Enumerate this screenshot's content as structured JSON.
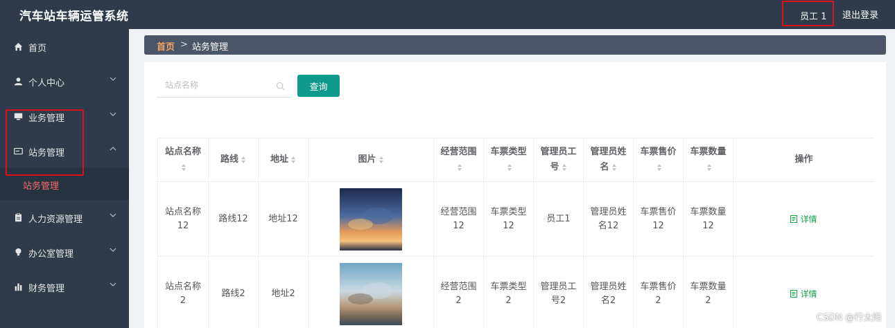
{
  "header": {
    "app_title": "汽车站车辆运管系统",
    "user_label": "员工 1",
    "logout_label": "退出登录"
  },
  "sidebar": {
    "items": [
      {
        "label": "首页",
        "icon": "home-icon"
      },
      {
        "label": "个人中心",
        "icon": "user-icon"
      },
      {
        "label": "业务管理",
        "icon": "monitor-icon"
      },
      {
        "label": "站务管理",
        "icon": "card-icon",
        "expanded": true,
        "children": [
          {
            "label": "站务管理"
          }
        ]
      },
      {
        "label": "人力资源管理",
        "icon": "clipboard-icon"
      },
      {
        "label": "办公室管理",
        "icon": "bulb-icon"
      },
      {
        "label": "财务管理",
        "icon": "bar-chart-icon"
      }
    ]
  },
  "breadcrumb": {
    "home": "首页",
    "separator": ">",
    "current": "站务管理"
  },
  "search": {
    "placeholder": "站点名称",
    "value": "",
    "button_label": "查询"
  },
  "table": {
    "columns": [
      {
        "l1": "站点名称",
        "l2": "",
        "sortable": true,
        "caret_on": 2
      },
      {
        "l1": "路线",
        "l2": "",
        "sortable": true,
        "caret_on": 1
      },
      {
        "l1": "地址",
        "l2": "",
        "sortable": true,
        "caret_on": 1
      },
      {
        "l1": "图片",
        "l2": "",
        "sortable": true,
        "caret_on": 1
      },
      {
        "l1": "经营范围",
        "l2": "",
        "sortable": true,
        "caret_on": 2
      },
      {
        "l1": "车票类型",
        "l2": "",
        "sortable": true,
        "caret_on": 2
      },
      {
        "l1": "管理员工",
        "l2": "号",
        "sortable": true,
        "caret_on": 2
      },
      {
        "l1": "管理员姓",
        "l2": "名",
        "sortable": true,
        "caret_on": 2
      },
      {
        "l1": "车票售价",
        "l2": "",
        "sortable": true,
        "caret_on": 2
      },
      {
        "l1": "车票数量",
        "l2": "",
        "sortable": true,
        "caret_on": 2
      },
      {
        "l1": "操作",
        "l2": "",
        "sortable": false,
        "caret_on": 0
      }
    ],
    "rows": [
      {
        "cells": [
          [
            "站点名称",
            "12"
          ],
          [
            "路线12"
          ],
          [
            "地址12"
          ],
          [
            "image-sunset-clouds"
          ],
          [
            "经营范围",
            "12"
          ],
          [
            "车票类型",
            "12"
          ],
          [
            "员工1"
          ],
          [
            "管理员姓",
            "名12"
          ],
          [
            "车票售价",
            "12"
          ],
          [
            "车票数量",
            "12"
          ],
          [
            "详情"
          ]
        ]
      },
      {
        "cells": [
          [
            "站点名称",
            "2"
          ],
          [
            "路线2"
          ],
          [
            "地址2"
          ],
          [
            "image-sky-aerial"
          ],
          [
            "经营范围",
            "2"
          ],
          [
            "车票类型",
            "2"
          ],
          [
            "管理员工",
            "号2"
          ],
          [
            "管理员姓",
            "名2"
          ],
          [
            "车票售价",
            "2"
          ],
          [
            "车票数量",
            "2"
          ],
          [
            "详情"
          ]
        ]
      }
    ],
    "action_label": "详情"
  },
  "watermark": "CSDN @行太阳",
  "colors": {
    "header_bg": "#2f3b4a",
    "sidebar_bg": "#2f3b4a",
    "accent_teal": "#0f9a8c",
    "active_submenu": "#f56c6c",
    "breadcrumb_home": "#f4a261",
    "highlight_red": "#e2101a",
    "detail_green": "#13a548"
  }
}
